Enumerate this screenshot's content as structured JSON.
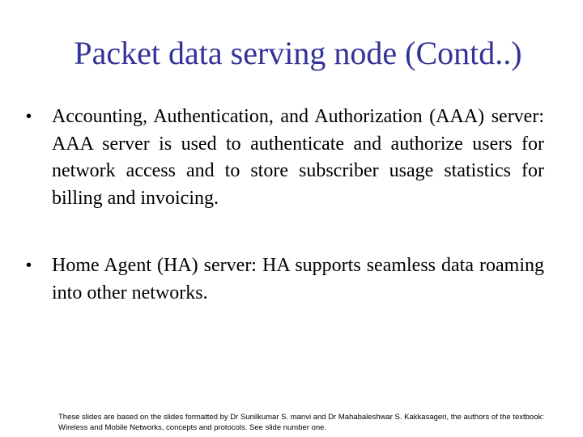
{
  "slide": {
    "title": "Packet data serving node (Contd..)",
    "title_color": "#333399",
    "bullets": [
      {
        "marker": "•",
        "text": "Accounting, Authentication, and Authorization (AAA) server: AAA server is used to authenticate and authorize users for network access and to store subscriber usage statistics for billing and invoicing."
      },
      {
        "marker": "•",
        "text": "Home Agent (HA) server: HA supports seamless data roaming into other networks."
      }
    ],
    "footer": "These slides are based on the slides formatted by Dr Sunilkumar S. manvi and Dr Mahabaleshwar S. Kakkasageri, the authors of the textbook: Wireless and Mobile Networks, concepts and protocols. See slide number one."
  }
}
